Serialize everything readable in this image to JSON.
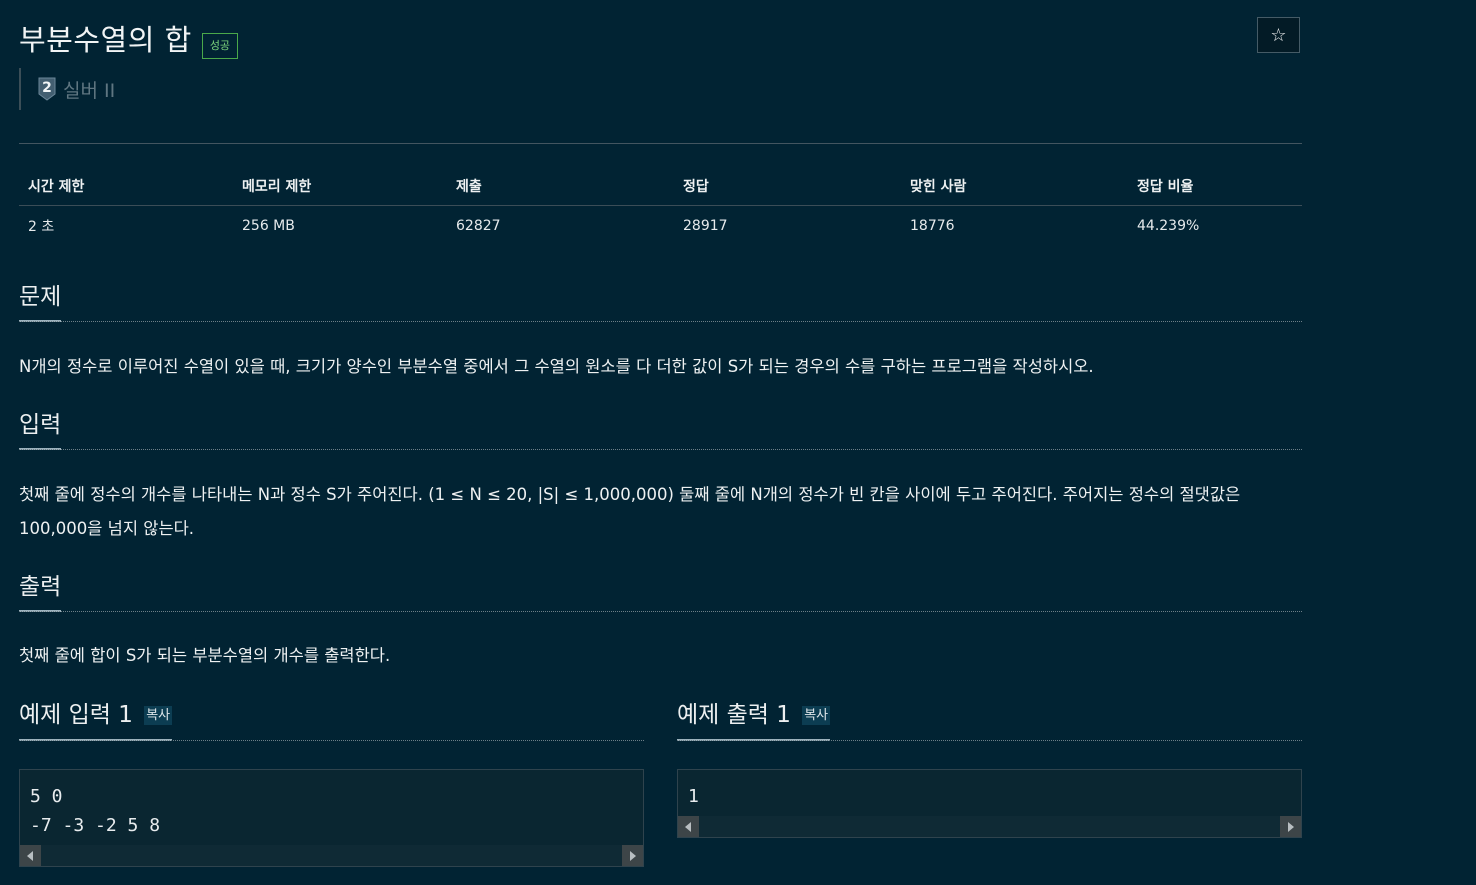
{
  "problem": {
    "title": "부분수열의 합",
    "status_badge": "성공",
    "tier_number": "2",
    "tier_label": "실버 II",
    "star_icon": "☆"
  },
  "info_table": {
    "headers": [
      "시간 제한",
      "메모리 제한",
      "제출",
      "정답",
      "맞힌 사람",
      "정답 비율"
    ],
    "values": [
      "2 초",
      "256 MB",
      "62827",
      "28917",
      "18776",
      "44.239%"
    ]
  },
  "sections": {
    "description_heading": "문제",
    "description_text": "N개의 정수로 이루어진 수열이 있을 때, 크기가 양수인 부분수열 중에서 그 수열의 원소를 다 더한 값이 S가 되는 경우의 수를 구하는 프로그램을 작성하시오.",
    "input_heading": "입력",
    "input_text": "첫째 줄에 정수의 개수를 나타내는 N과 정수 S가 주어진다. (1 ≤ N ≤ 20, |S| ≤ 1,000,000) 둘째 줄에 N개의 정수가 빈 칸을 사이에 두고 주어진다. 주어지는 정수의 절댓값은 100,000을 넘지 않는다.",
    "output_heading": "출력",
    "output_text": "첫째 줄에 합이 S가 되는 부분수열의 개수를 출력한다."
  },
  "samples": {
    "input_heading": "예제 입력 1",
    "output_heading": "예제 출력 1",
    "copy_label": "복사",
    "input_body": "5 0\n-7 -3 -2 5 8",
    "output_body": "1"
  },
  "colors": {
    "background": "#012333",
    "success_green": "#7bd27b",
    "tier_silver": "#5f7681"
  }
}
